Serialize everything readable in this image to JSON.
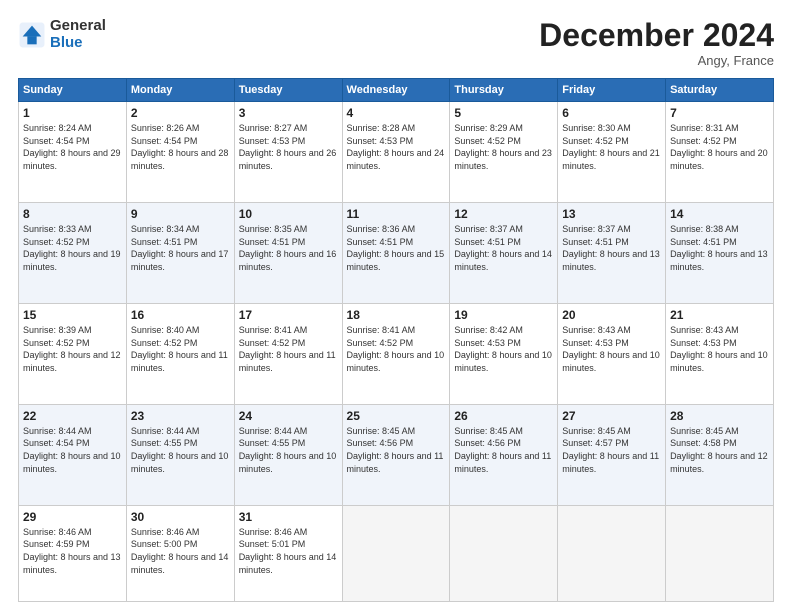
{
  "header": {
    "logo_general": "General",
    "logo_blue": "Blue",
    "month_title": "December 2024",
    "location": "Angy, France"
  },
  "weekdays": [
    "Sunday",
    "Monday",
    "Tuesday",
    "Wednesday",
    "Thursday",
    "Friday",
    "Saturday"
  ],
  "weeks": [
    [
      {
        "day": "1",
        "sunrise": "8:24 AM",
        "sunset": "4:54 PM",
        "daylight": "8 hours and 29 minutes."
      },
      {
        "day": "2",
        "sunrise": "8:26 AM",
        "sunset": "4:54 PM",
        "daylight": "8 hours and 28 minutes."
      },
      {
        "day": "3",
        "sunrise": "8:27 AM",
        "sunset": "4:53 PM",
        "daylight": "8 hours and 26 minutes."
      },
      {
        "day": "4",
        "sunrise": "8:28 AM",
        "sunset": "4:53 PM",
        "daylight": "8 hours and 24 minutes."
      },
      {
        "day": "5",
        "sunrise": "8:29 AM",
        "sunset": "4:52 PM",
        "daylight": "8 hours and 23 minutes."
      },
      {
        "day": "6",
        "sunrise": "8:30 AM",
        "sunset": "4:52 PM",
        "daylight": "8 hours and 21 minutes."
      },
      {
        "day": "7",
        "sunrise": "8:31 AM",
        "sunset": "4:52 PM",
        "daylight": "8 hours and 20 minutes."
      }
    ],
    [
      {
        "day": "8",
        "sunrise": "8:33 AM",
        "sunset": "4:52 PM",
        "daylight": "8 hours and 19 minutes."
      },
      {
        "day": "9",
        "sunrise": "8:34 AM",
        "sunset": "4:51 PM",
        "daylight": "8 hours and 17 minutes."
      },
      {
        "day": "10",
        "sunrise": "8:35 AM",
        "sunset": "4:51 PM",
        "daylight": "8 hours and 16 minutes."
      },
      {
        "day": "11",
        "sunrise": "8:36 AM",
        "sunset": "4:51 PM",
        "daylight": "8 hours and 15 minutes."
      },
      {
        "day": "12",
        "sunrise": "8:37 AM",
        "sunset": "4:51 PM",
        "daylight": "8 hours and 14 minutes."
      },
      {
        "day": "13",
        "sunrise": "8:37 AM",
        "sunset": "4:51 PM",
        "daylight": "8 hours and 13 minutes."
      },
      {
        "day": "14",
        "sunrise": "8:38 AM",
        "sunset": "4:51 PM",
        "daylight": "8 hours and 13 minutes."
      }
    ],
    [
      {
        "day": "15",
        "sunrise": "8:39 AM",
        "sunset": "4:52 PM",
        "daylight": "8 hours and 12 minutes."
      },
      {
        "day": "16",
        "sunrise": "8:40 AM",
        "sunset": "4:52 PM",
        "daylight": "8 hours and 11 minutes."
      },
      {
        "day": "17",
        "sunrise": "8:41 AM",
        "sunset": "4:52 PM",
        "daylight": "8 hours and 11 minutes."
      },
      {
        "day": "18",
        "sunrise": "8:41 AM",
        "sunset": "4:52 PM",
        "daylight": "8 hours and 10 minutes."
      },
      {
        "day": "19",
        "sunrise": "8:42 AM",
        "sunset": "4:53 PM",
        "daylight": "8 hours and 10 minutes."
      },
      {
        "day": "20",
        "sunrise": "8:43 AM",
        "sunset": "4:53 PM",
        "daylight": "8 hours and 10 minutes."
      },
      {
        "day": "21",
        "sunrise": "8:43 AM",
        "sunset": "4:53 PM",
        "daylight": "8 hours and 10 minutes."
      }
    ],
    [
      {
        "day": "22",
        "sunrise": "8:44 AM",
        "sunset": "4:54 PM",
        "daylight": "8 hours and 10 minutes."
      },
      {
        "day": "23",
        "sunrise": "8:44 AM",
        "sunset": "4:55 PM",
        "daylight": "8 hours and 10 minutes."
      },
      {
        "day": "24",
        "sunrise": "8:44 AM",
        "sunset": "4:55 PM",
        "daylight": "8 hours and 10 minutes."
      },
      {
        "day": "25",
        "sunrise": "8:45 AM",
        "sunset": "4:56 PM",
        "daylight": "8 hours and 11 minutes."
      },
      {
        "day": "26",
        "sunrise": "8:45 AM",
        "sunset": "4:56 PM",
        "daylight": "8 hours and 11 minutes."
      },
      {
        "day": "27",
        "sunrise": "8:45 AM",
        "sunset": "4:57 PM",
        "daylight": "8 hours and 11 minutes."
      },
      {
        "day": "28",
        "sunrise": "8:45 AM",
        "sunset": "4:58 PM",
        "daylight": "8 hours and 12 minutes."
      }
    ],
    [
      {
        "day": "29",
        "sunrise": "8:46 AM",
        "sunset": "4:59 PM",
        "daylight": "8 hours and 13 minutes."
      },
      {
        "day": "30",
        "sunrise": "8:46 AM",
        "sunset": "5:00 PM",
        "daylight": "8 hours and 14 minutes."
      },
      {
        "day": "31",
        "sunrise": "8:46 AM",
        "sunset": "5:01 PM",
        "daylight": "8 hours and 14 minutes."
      },
      null,
      null,
      null,
      null
    ]
  ],
  "labels": {
    "sunrise": "Sunrise: ",
    "sunset": "Sunset: ",
    "daylight": "Daylight: "
  }
}
